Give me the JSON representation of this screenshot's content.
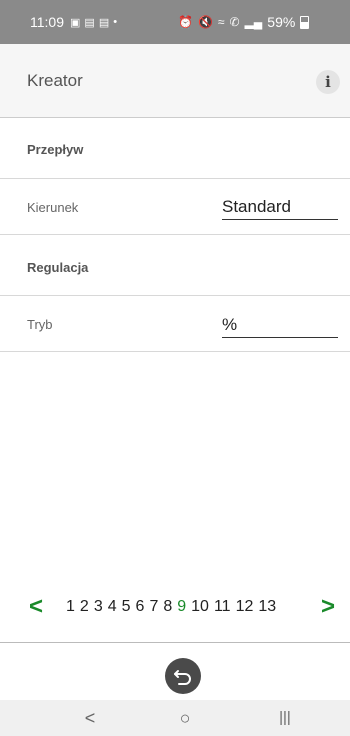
{
  "status_bar": {
    "time": "11:09",
    "battery": "59%",
    "icons": [
      "image-icon",
      "notification-icon",
      "notification-icon",
      "dot-icon",
      "alarm-icon",
      "mute-icon",
      "wifi-icon",
      "call-icon",
      "signal-icon",
      "battery-icon"
    ]
  },
  "header": {
    "title": "Kreator",
    "info_label": "i"
  },
  "sections": {
    "flow_title": "Przepływ",
    "direction_label": "Kierunek",
    "direction_value": "Standard",
    "regulation_title": "Regulacja",
    "mode_label": "Tryb",
    "mode_value": "%"
  },
  "pager": {
    "prev": "<",
    "next": ">",
    "pages": [
      "1",
      "2",
      "3",
      "4",
      "5",
      "6",
      "7",
      "8",
      "9",
      "10",
      "11",
      "12",
      "13"
    ],
    "current": "9",
    "accent_color": "#1a8a2a"
  },
  "nav_bar": {
    "back": "<",
    "home": "○",
    "recents": "|||"
  }
}
